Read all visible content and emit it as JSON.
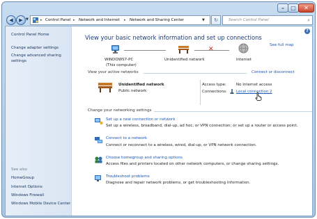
{
  "window": {
    "controls": {
      "minimize": "–",
      "maximize": "□",
      "close": "✕"
    }
  },
  "address": {
    "crumbs": [
      "Control Panel",
      "Network and Internet",
      "Network and Sharing Center"
    ],
    "search_placeholder": "Search Control Panel"
  },
  "sidebar": {
    "home": "Control Panel Home",
    "tasks": [
      "Change adapter settings",
      "Change advanced sharing",
      "settings"
    ],
    "see_also": "See also",
    "links": [
      "HomeGroup",
      "Internet Options",
      "Windows Firewall",
      "Windows Mobile Device Center"
    ]
  },
  "main": {
    "title": "View your basic network information and set up connections",
    "see_full_map": "See full map",
    "map": {
      "computer_name": "WINDOWS7-PC",
      "computer_sub": "(This computer)",
      "network": "Unidentified network",
      "internet": "Internet"
    },
    "active": {
      "heading": "View your active networks",
      "connect_link": "Connect or disconnect",
      "network_name": "Unidentified network",
      "network_type": "Public network",
      "access_label": "Access type:",
      "access_value": "No Internet access",
      "connections_label": "Connections:",
      "connections_value": "Local connection 2"
    },
    "change": {
      "heading": "Change your networking settings",
      "tasks": [
        {
          "title": "Set up a new connection or network",
          "desc": "Set up a wireless, broadband, dial-up, ad hoc, or VPN connection; or set up a router or access point."
        },
        {
          "title": "Connect to a network",
          "desc": "Connect or reconnect to a wireless, wired, dial-up, or VPN network connection."
        },
        {
          "title": "Choose homegroup and sharing options",
          "desc": "Access files and printers located on other network computers, or change sharing settings."
        },
        {
          "title": "Troubleshoot problems",
          "desc": "Diagnose and repair network problems, or get troubleshooting information."
        }
      ]
    }
  },
  "colors": {
    "accent": "#1a55b8",
    "title": "#1e3c78",
    "frame": "#a9c6e4"
  }
}
